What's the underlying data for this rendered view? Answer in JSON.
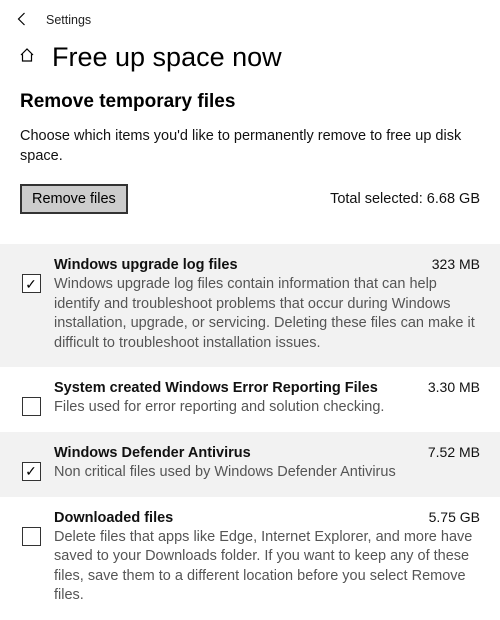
{
  "app_name": "Settings",
  "page_title": "Free up space now",
  "section": {
    "heading": "Remove temporary files",
    "description": "Choose which items you'd like to permanently remove to free up disk space.",
    "button_label": "Remove files",
    "total_label": "Total selected: 6.68 GB"
  },
  "items": [
    {
      "title": "Windows upgrade log files",
      "size": "323 MB",
      "desc": "Windows upgrade log files contain information that can help identify and troubleshoot problems that occur during Windows installation, upgrade, or servicing.  Deleting these files can make it difficult to troubleshoot installation issues.",
      "checked": true,
      "shaded": true
    },
    {
      "title": "System created Windows Error Reporting Files",
      "size": "3.30 MB",
      "desc": "Files used for error reporting and solution checking.",
      "checked": false,
      "shaded": false
    },
    {
      "title": "Windows Defender Antivirus",
      "size": "7.52 MB",
      "desc": "Non critical files used by Windows Defender Antivirus",
      "checked": true,
      "shaded": true
    },
    {
      "title": "Downloaded files",
      "size": "5.75 GB",
      "desc": "Delete files that apps like Edge, Internet Explorer, and more have saved to your Downloads folder. If you want to keep any of these files, save them to a different location before you select Remove files.",
      "checked": false,
      "shaded": false
    }
  ]
}
